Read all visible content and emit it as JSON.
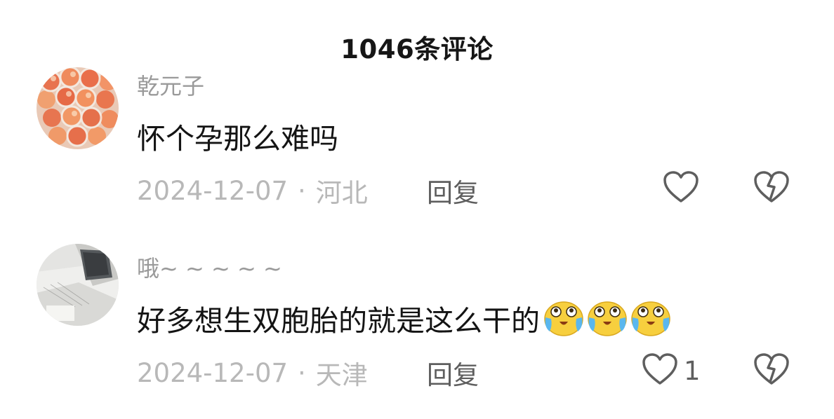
{
  "header": {
    "title": "1046条评论"
  },
  "comments": [
    {
      "username": "乾元子",
      "text": "怀个孕那么难吗",
      "date": "2024-12-07",
      "separator": "·",
      "location": "河北",
      "reply_label": "回复",
      "like_count": "",
      "avatar_icon": "peaches-photo-avatar",
      "emojis": []
    },
    {
      "username": "哦~ ~ ~ ~ ~",
      "text": "好多想生双胞胎的就是这么干的",
      "date": "2024-12-07",
      "separator": "·",
      "location": "天津",
      "reply_label": "回复",
      "like_count": "1",
      "avatar_icon": "desk-photo-avatar",
      "emojis": [
        "crying-laughing-emoji",
        "crying-laughing-emoji",
        "crying-laughing-emoji"
      ]
    }
  ],
  "colors": {
    "username": "#9a9a9a",
    "text": "#141414",
    "meta": "#b8b8b8",
    "action": "#5e5e5e",
    "emoji_yellow": "#f7cf3e",
    "emoji_tear": "#5ab7ee"
  }
}
